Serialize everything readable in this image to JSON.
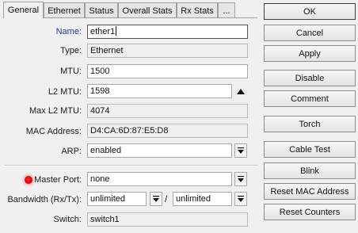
{
  "tabs": [
    {
      "label": "General",
      "active": true
    },
    {
      "label": "Ethernet",
      "active": false
    },
    {
      "label": "Status",
      "active": false
    },
    {
      "label": "Overall Stats",
      "active": false
    },
    {
      "label": "Rx Stats",
      "active": false
    },
    {
      "label": "...",
      "active": false
    }
  ],
  "form": {
    "name": {
      "label": "Name:",
      "value": "ether1"
    },
    "type": {
      "label": "Type:",
      "value": "Ethernet"
    },
    "mtu": {
      "label": "MTU:",
      "value": "1500"
    },
    "l2mtu": {
      "label": "L2 MTU:",
      "value": "1598"
    },
    "max_l2mtu": {
      "label": "Max L2 MTU:",
      "value": "4074"
    },
    "mac": {
      "label": "MAC Address:",
      "value": "D4:CA:6D:87:E5:D8"
    },
    "arp": {
      "label": "ARP:",
      "value": "enabled"
    },
    "master_port": {
      "label": "Master Port:",
      "value": "none"
    },
    "bandwidth": {
      "label": "Bandwidth (Rx/Tx):",
      "rx": "unlimited",
      "separator": "/",
      "tx": "unlimited"
    },
    "switch": {
      "label": "Switch:",
      "value": "switch1"
    }
  },
  "buttons": {
    "ok": "OK",
    "cancel": "Cancel",
    "apply": "Apply",
    "disable": "Disable",
    "comment": "Comment",
    "torch": "Torch",
    "cable_test": "Cable Test",
    "blink": "Blink",
    "reset_mac": "Reset MAC Address",
    "reset_counters": "Reset Counters"
  },
  "colors": {
    "name_label": "#1f3ca8",
    "status_dot": "#e00000"
  },
  "icons": {
    "dropdown": "dropdown-arrow-icon",
    "l2mtu_toggle": "up-triangle-icon",
    "master_port_status": "red-dot-icon"
  }
}
